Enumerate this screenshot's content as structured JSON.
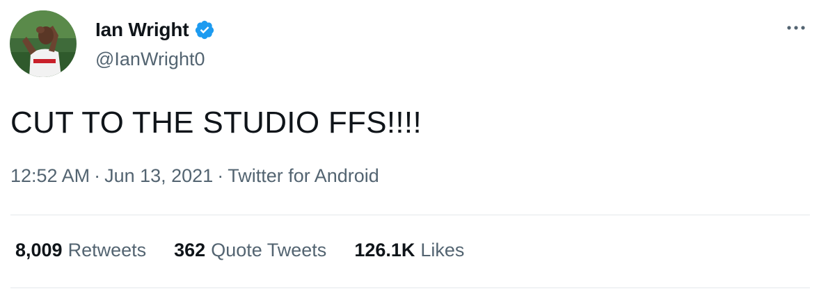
{
  "author": {
    "display_name": "Ian Wright",
    "handle": "@IanWright0",
    "verified": true,
    "avatar": "profile-photo"
  },
  "tweet": {
    "text": "CUT TO THE STUDIO FFS!!!!",
    "time": "12:52 AM",
    "date": "Jun 13, 2021",
    "source": "Twitter for Android",
    "separator": "·"
  },
  "stats": [
    {
      "count": "8,009",
      "label": "Retweets"
    },
    {
      "count": "362",
      "label": "Quote Tweets"
    },
    {
      "count": "126.1K",
      "label": "Likes"
    }
  ],
  "icons": {
    "verified": "verified-badge-icon",
    "more": "more-horizontal-icon"
  },
  "colors": {
    "text_primary": "#0f1419",
    "text_secondary": "#536471",
    "verified_blue": "#1d9bf0",
    "divider": "#e4e8eb"
  }
}
